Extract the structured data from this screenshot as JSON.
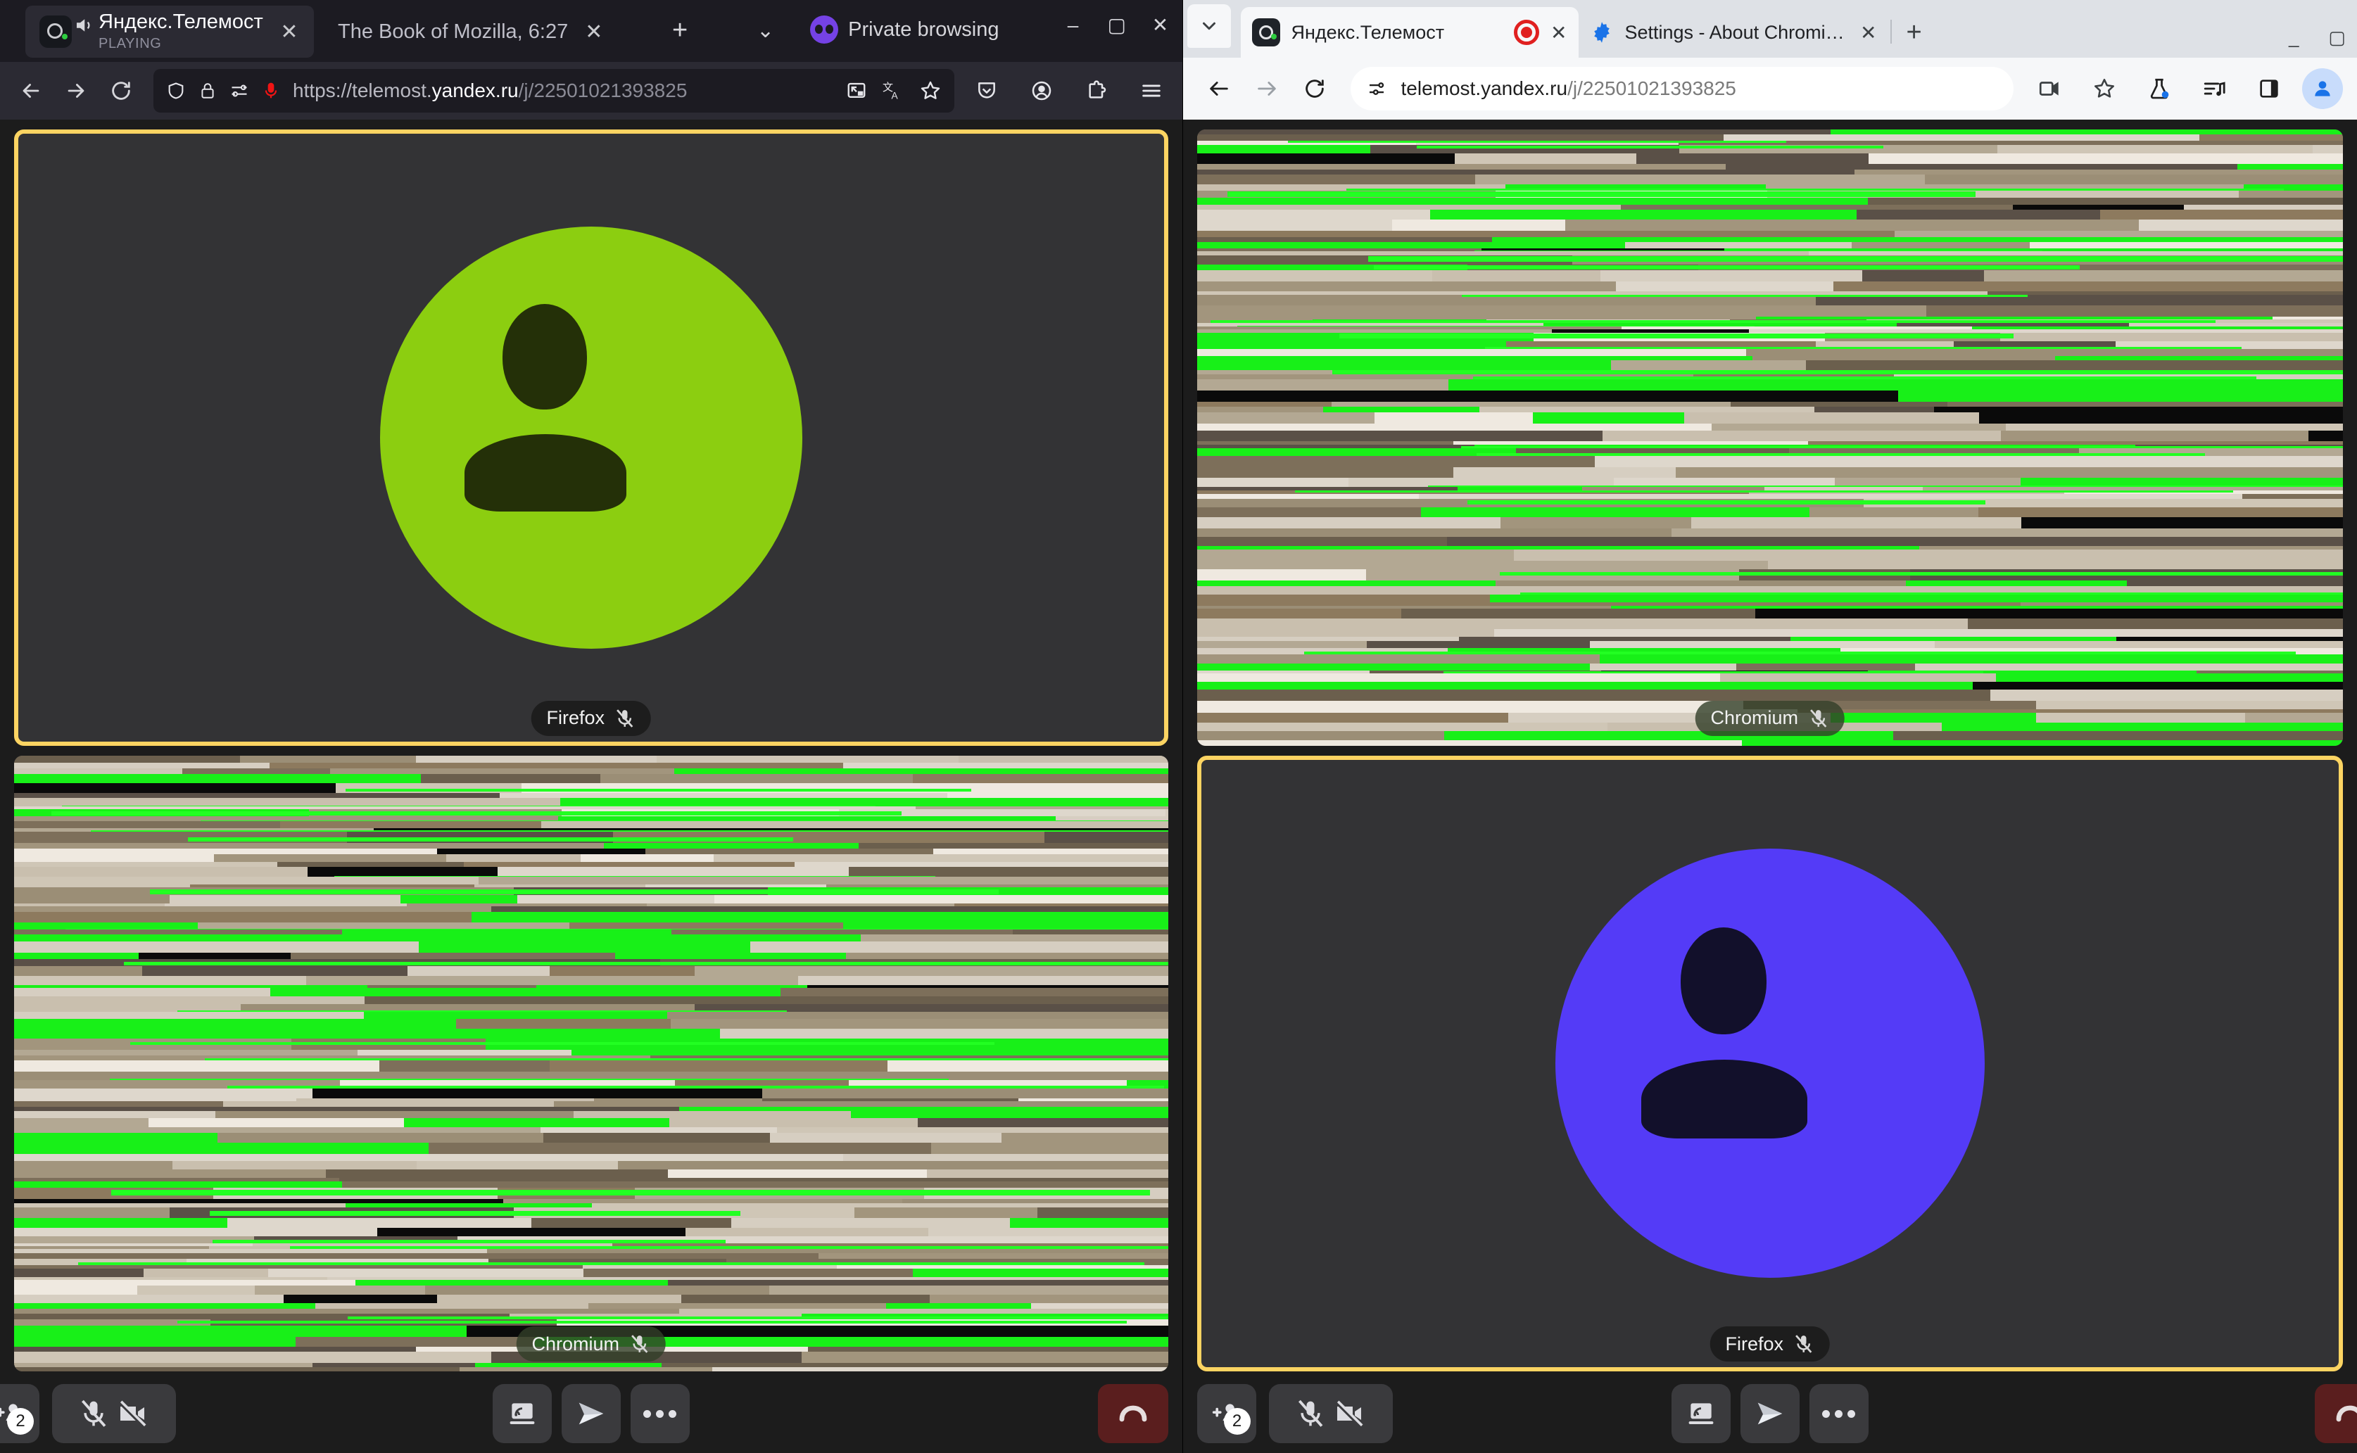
{
  "firefox_window": {
    "tabs": {
      "active": {
        "title": "Яндекс.Телемост",
        "status": "PLAYING",
        "favicon": "yandex-telemost-favicon",
        "sound_icon": "speaker-playing-icon",
        "close_label": "✕"
      },
      "second": {
        "title": "The Book of Mozilla, 6:27",
        "close_label": "✕"
      },
      "new_tab_label": "+",
      "list_all_tabs_label": "⌄"
    },
    "private_browsing_label": "Private browsing",
    "window_controls": {
      "minimize": "–",
      "maximize": "▢",
      "close": "✕"
    },
    "navbar": {
      "back_label": "←",
      "forward_label": "→",
      "reload_label": "⟳",
      "url_prefix": "https://telemost.",
      "url_domain": "yandex.ru",
      "url_path": "/j/22501021393825",
      "url_full": "https://telemost.yandex.ru/j/22501021393825",
      "left_icons": [
        "shield-icon",
        "lock-icon",
        "permissions-icon",
        "microphone-active-icon"
      ],
      "right_inside_icons": [
        "picture-in-picture-icon",
        "translate-icon",
        "bookmark-star-icon"
      ],
      "right_outside_icons": [
        "pocket-icon",
        "account-icon",
        "extensions-icon",
        "app-menu-icon"
      ]
    }
  },
  "chromium_window": {
    "tab_search_label": "⌄",
    "tabs": [
      {
        "title": "Яндекс.Телемост",
        "favicon": "yandex-telemost-favicon",
        "recording": true,
        "close_label": "✕",
        "active": true
      },
      {
        "title": "Settings - About Chromium",
        "favicon": "gear-icon",
        "recording": false,
        "close_label": "✕",
        "active": false
      }
    ],
    "new_tab_label": "+",
    "window_controls": {
      "minimize": "_",
      "maximize": "▢"
    },
    "toolbar": {
      "back_label": "←",
      "forward_label": "→",
      "reload_label": "⟳",
      "site_info_icon": "tune-icon",
      "url_domain": "telemost.yandex.ru",
      "url_path": "/j/22501021393825",
      "url_full": "telemost.yandex.ru/j/22501021393825",
      "right_icons": [
        "camera-sharing-icon",
        "bookmark-star-icon",
        "experiments-flask-icon",
        "media-control-icon",
        "side-panel-icon",
        "profile-avatar-icon"
      ]
    }
  },
  "call": {
    "firefox_view": {
      "tiles": [
        {
          "kind": "avatar",
          "name": "Firefox",
          "muted": true,
          "focused": true,
          "avatar_color": "#8CCE10",
          "avatar_icon_color": "#243008",
          "nameplate_style": "dark"
        },
        {
          "kind": "video",
          "name": "Chromium",
          "muted": true,
          "focused": false,
          "nameplate_style": "over-video"
        }
      ]
    },
    "chromium_view": {
      "tiles": [
        {
          "kind": "video",
          "name": "Chromium",
          "muted": true,
          "focused": false,
          "nameplate_style": "over-video"
        },
        {
          "kind": "avatar",
          "name": "Firefox",
          "muted": true,
          "focused": true,
          "avatar_color": "#543BF7",
          "avatar_icon_color": "#12102B",
          "nameplate_style": "dark"
        }
      ]
    },
    "controls": {
      "add_participant": {
        "icon": "add-person-icon",
        "badge": "2"
      },
      "microphone": {
        "icon": "microphone-off-icon",
        "state": "muted"
      },
      "camera": {
        "icon": "camera-off-icon",
        "state": "off"
      },
      "share_screen": {
        "icon": "screen-share-icon"
      },
      "send": {
        "icon": "send-icon"
      },
      "more": {
        "icon": "more-horizontal-icon"
      },
      "hangup": {
        "icon": "hangup-icon"
      }
    }
  },
  "theme": {
    "focus_border": "#FCD462",
    "hangup_bg": "#5A1E1E",
    "tile_bg": "#333335",
    "call_bg": "#1C1C1C",
    "control_btn_bg": "#3A3A3D"
  }
}
